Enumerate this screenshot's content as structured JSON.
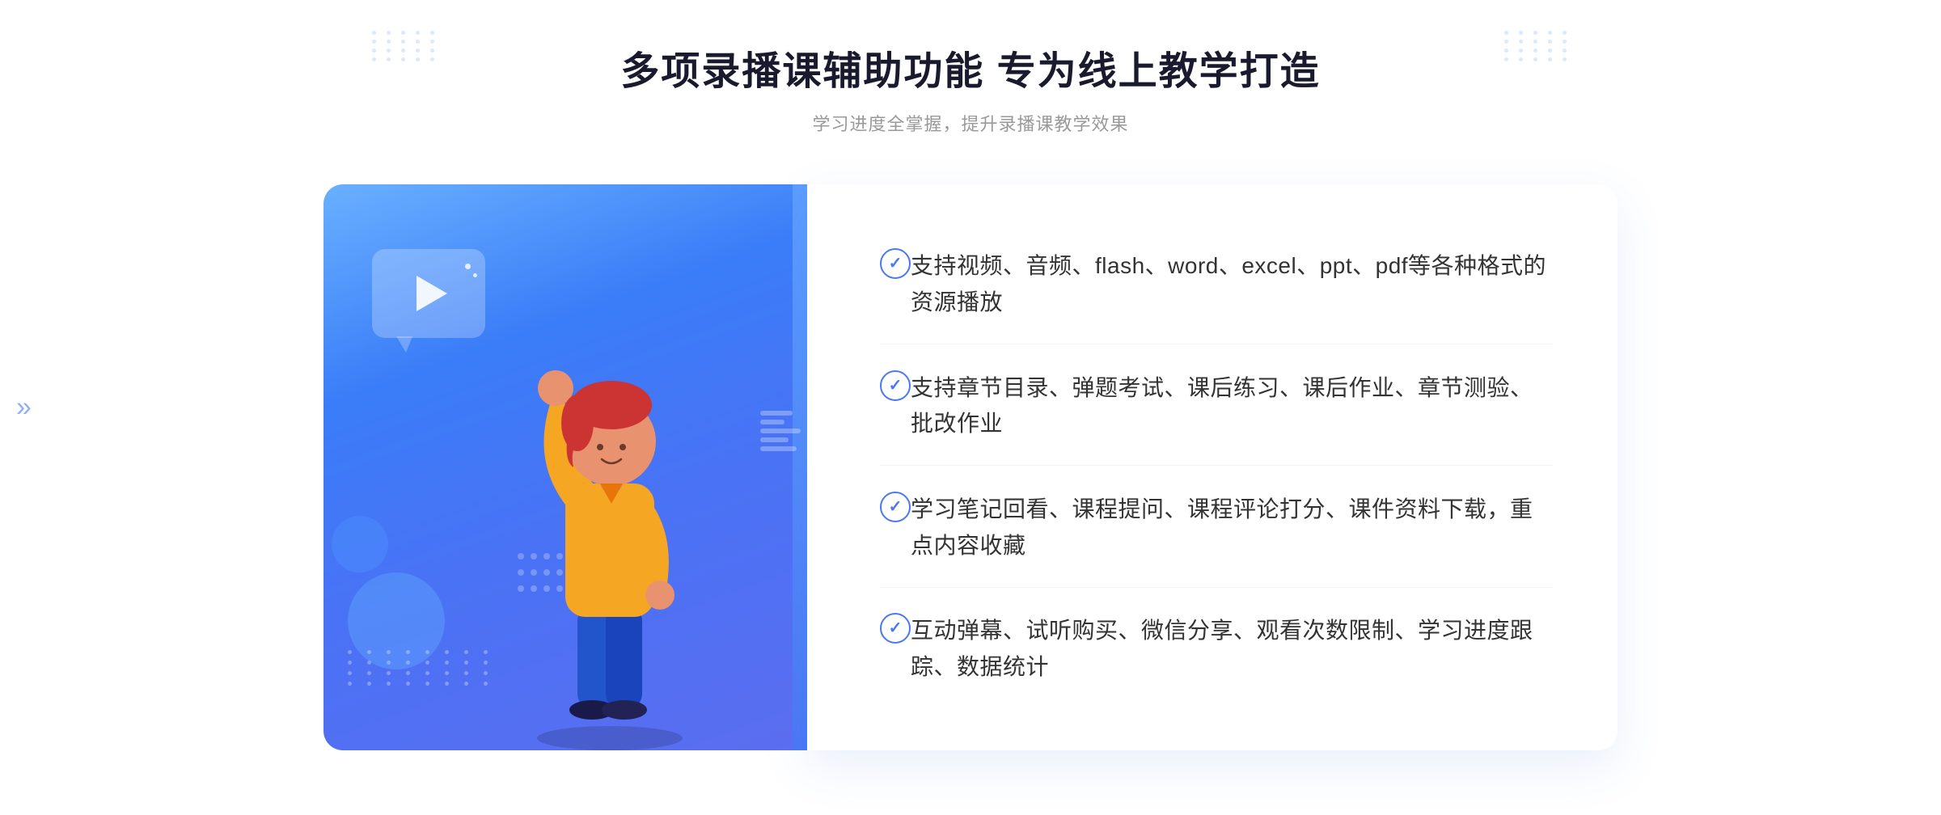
{
  "header": {
    "main_title": "多项录播课辅助功能 专为线上教学打造",
    "sub_title": "学习进度全掌握，提升录播课教学效果"
  },
  "features": [
    {
      "id": "feature-1",
      "text": "支持视频、音频、flash、word、excel、ppt、pdf等各种格式的资源播放"
    },
    {
      "id": "feature-2",
      "text": "支持章节目录、弹题考试、课后练习、课后作业、章节测验、批改作业"
    },
    {
      "id": "feature-3",
      "text": "学习笔记回看、课程提问、课程评论打分、课件资料下载，重点内容收藏"
    },
    {
      "id": "feature-4",
      "text": "互动弹幕、试听购买、微信分享、观看次数限制、学习进度跟踪、数据统计"
    }
  ],
  "decoration": {
    "dots_color": "#4a78f5",
    "check_color": "#4a78f5"
  }
}
